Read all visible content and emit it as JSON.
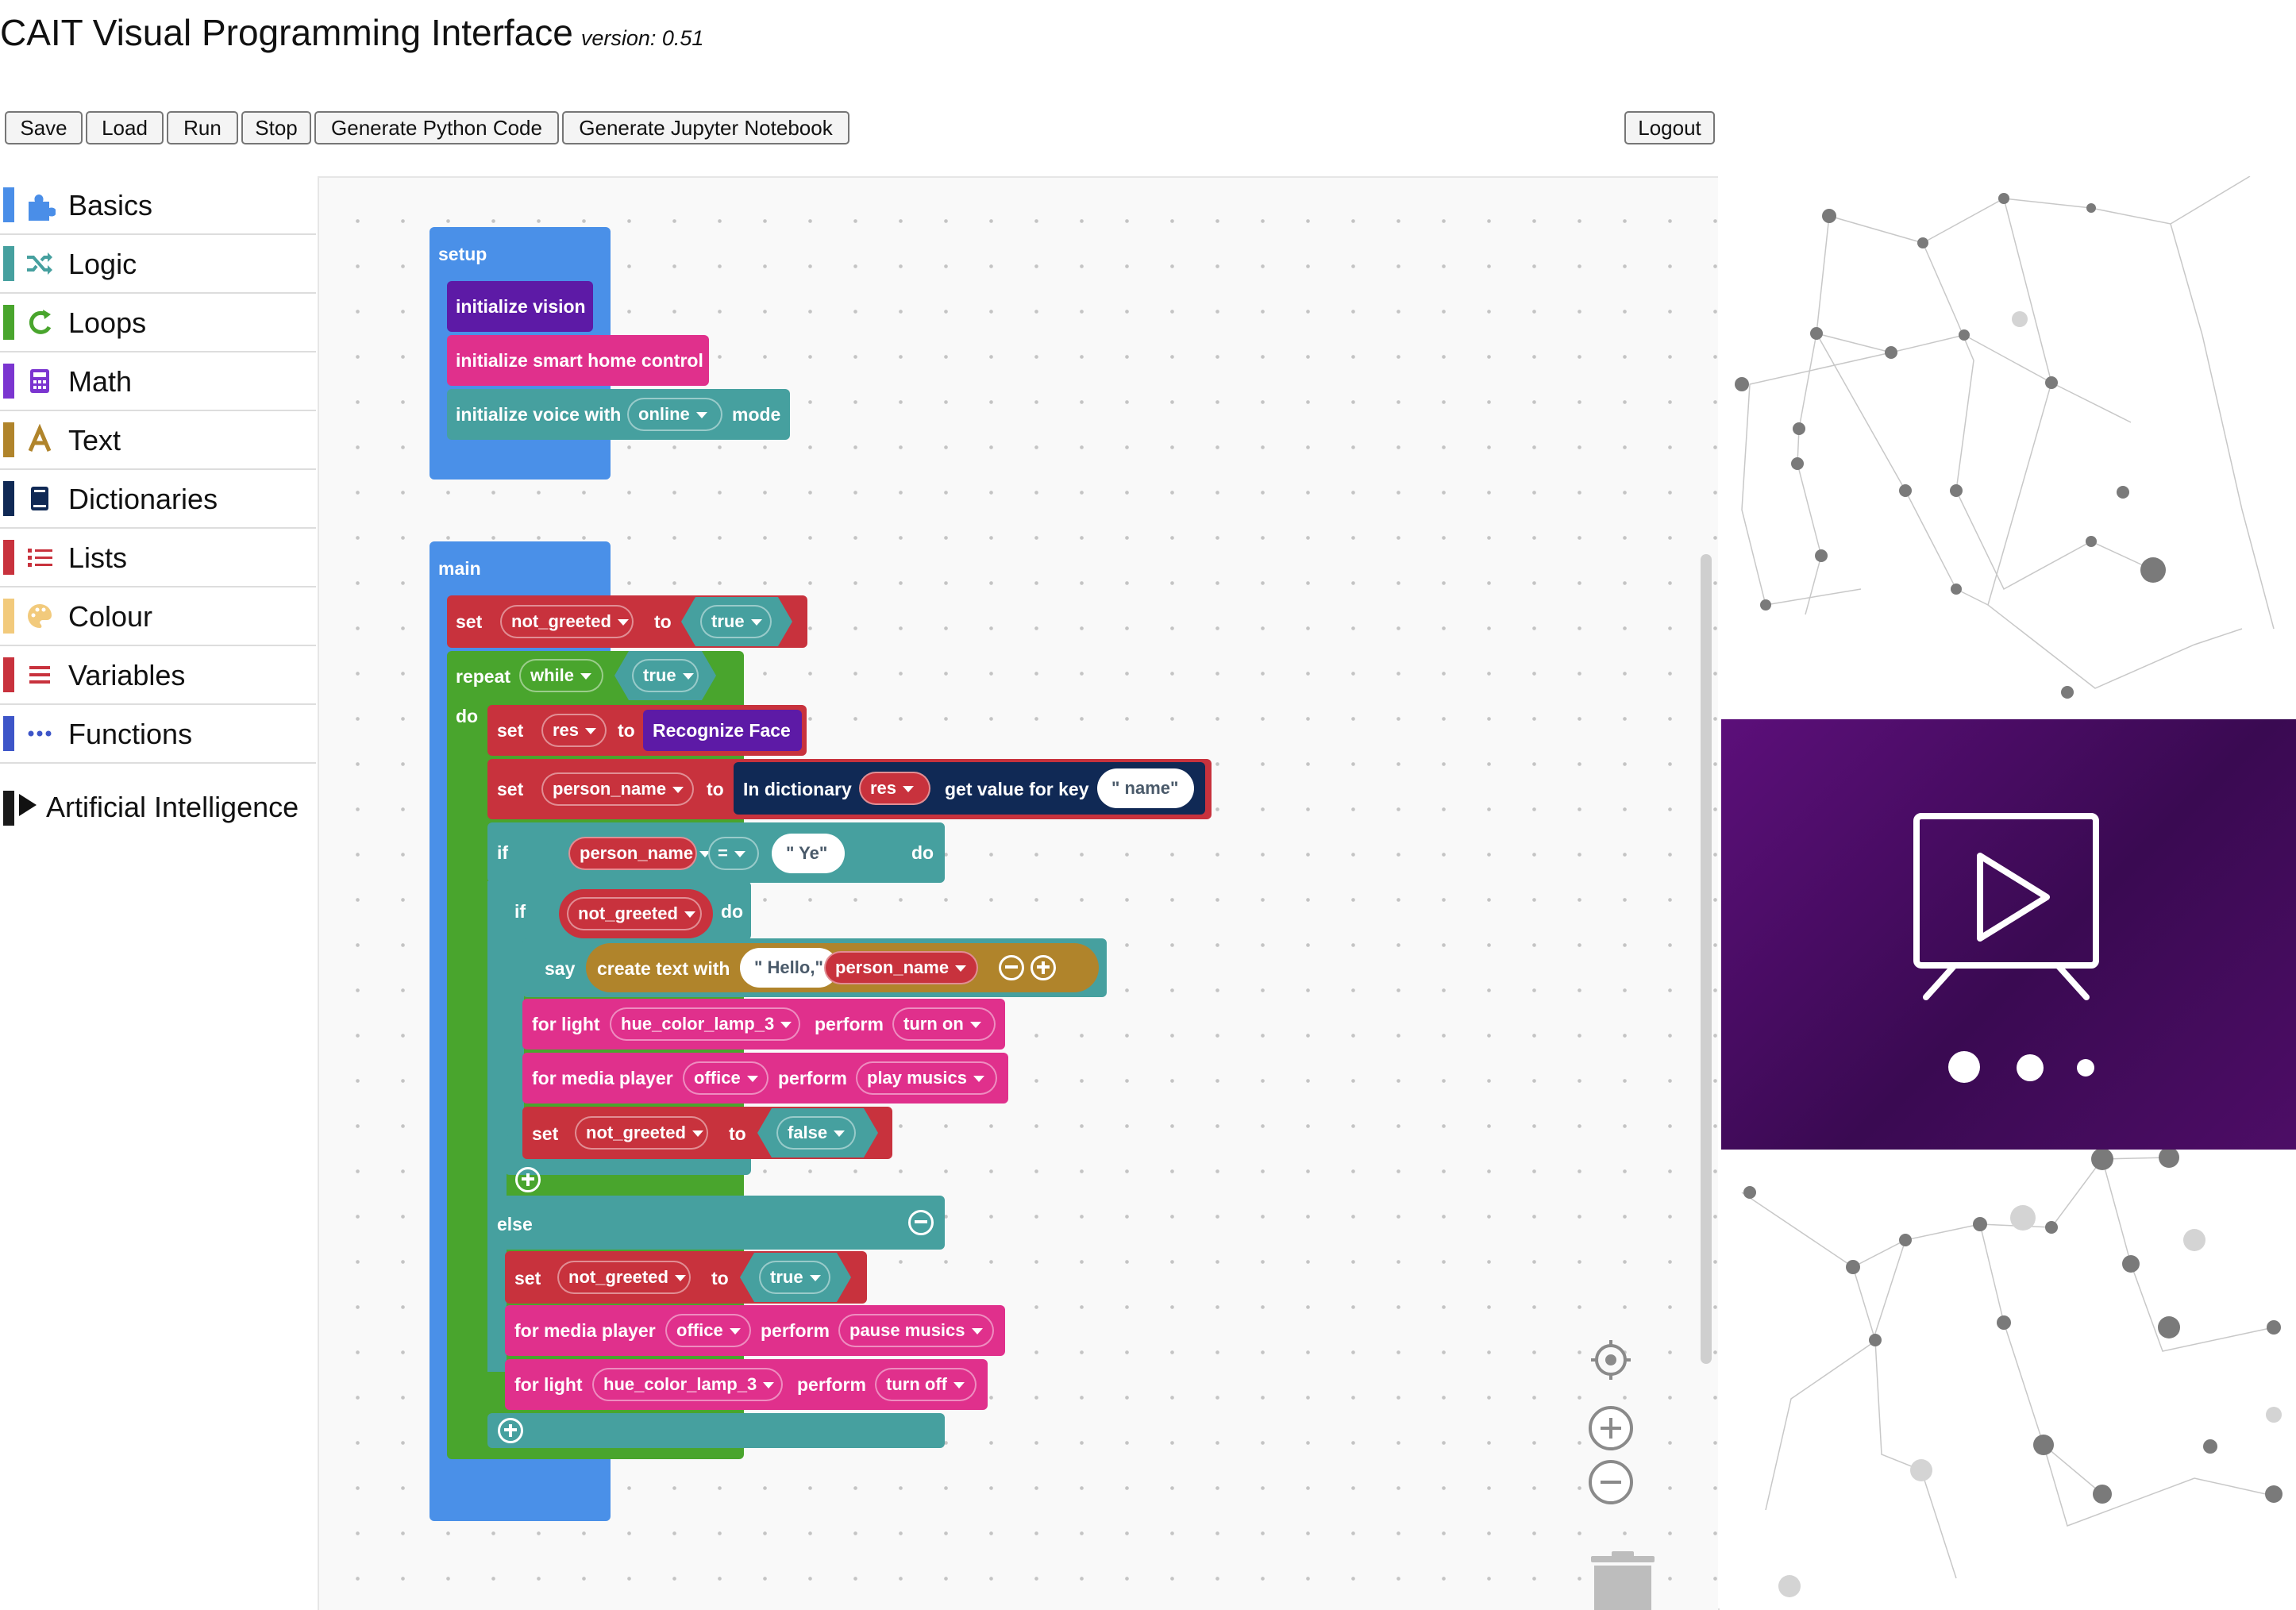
{
  "app": {
    "title": "CAIT Visual Programming Interface",
    "version": "version: 0.51"
  },
  "toolbar": {
    "buttons": [
      "Save",
      "Load",
      "Run",
      "Stop",
      "Generate Python Code",
      "Generate Jupyter Notebook"
    ],
    "logout": "Logout"
  },
  "sidebar": {
    "categories": [
      {
        "label": "Basics",
        "color": "#4a8ee8",
        "icon": "puzzle-icon"
      },
      {
        "label": "Logic",
        "color": "#46a09f",
        "icon": "shuffle-icon"
      },
      {
        "label": "Loops",
        "color": "#49a52d",
        "icon": "loop-arrow-icon"
      },
      {
        "label": "Math",
        "color": "#7b35d0",
        "icon": "calculator-icon"
      },
      {
        "label": "Text",
        "color": "#b0842b",
        "icon": "letter-a-icon"
      },
      {
        "label": "Dictionaries",
        "color": "#102955",
        "icon": "book-icon"
      },
      {
        "label": "Lists",
        "color": "#c8323d",
        "icon": "list-icon"
      },
      {
        "label": "Colour",
        "color": "#f2ca7c",
        "icon": "palette-icon"
      },
      {
        "label": "Variables",
        "color": "#c8323d",
        "icon": "menu-lines-icon"
      },
      {
        "label": "Functions",
        "color": "#3d55c8",
        "icon": "ellipsis-icon"
      }
    ],
    "ai_category": "Artificial Intelligence"
  },
  "colors": {
    "setup_blue": "#4a90e8",
    "vision_purple": "#5d1aa6",
    "smart_pink": "#e0308c",
    "voice_teal": "#46a09f",
    "loop_green": "#49a52d",
    "var_red": "#c8323d",
    "dict_navy": "#102955",
    "text_gold": "#b0842b",
    "video_purple": "#4d0d66"
  },
  "blocks": {
    "setup": {
      "title": "setup",
      "init_vision": "initialize vision",
      "init_smart": "initialize smart home control",
      "init_voice": "initialize voice with",
      "voice_mode": "online",
      "mode_suffix": "mode"
    },
    "main": {
      "title": "main",
      "set1": {
        "kw": "set",
        "var": "not_greeted",
        "to": "to",
        "val": "true"
      },
      "repeat": {
        "kw": "repeat",
        "mode": "while",
        "cond": "true",
        "do": "do"
      },
      "set_res": {
        "kw": "set",
        "var": "res",
        "to": "to",
        "val": "Recognize Face"
      },
      "set_person": {
        "kw": "set",
        "var": "person_name",
        "to": "to",
        "dict_kw": "In dictionary",
        "dict_var": "res",
        "get_kw": "get value for key",
        "key": "\" name\""
      },
      "if_outer": {
        "kw": "if",
        "lhs": "person_name",
        "op": "=",
        "rhs": "\" Ye\"",
        "do": "do"
      },
      "if_inner": {
        "kw": "if",
        "cond": "not_greeted",
        "do": "do"
      },
      "say": {
        "kw": "say",
        "create": "create text with",
        "str": "\" Hello,\"",
        "var": "person_name"
      },
      "light_on": {
        "kw": "for light",
        "lamp": "hue_color_lamp_3",
        "perform": "perform",
        "action": "turn on"
      },
      "media_play": {
        "kw": "for media player",
        "player": "office",
        "perform": "perform",
        "action": "play musics"
      },
      "set_false": {
        "kw": "set",
        "var": "not_greeted",
        "to": "to",
        "val": "false"
      },
      "else": "else",
      "set_true": {
        "kw": "set",
        "var": "not_greeted",
        "to": "to",
        "val": "true"
      },
      "media_pause": {
        "kw": "for media player",
        "player": "office",
        "perform": "perform",
        "action": "pause musics"
      },
      "light_off": {
        "kw": "for light",
        "lamp": "hue_color_lamp_3",
        "perform": "perform",
        "action": "turn off"
      }
    }
  }
}
